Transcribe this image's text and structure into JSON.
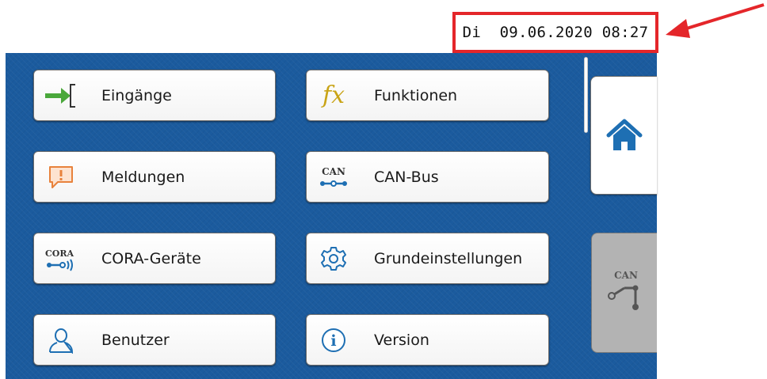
{
  "header": {
    "datetime": "Di  09.06.2020 08:27"
  },
  "menu": {
    "items": [
      {
        "label": "Eingänge",
        "icon": "input-arrow-icon"
      },
      {
        "label": "Funktionen",
        "icon": "function-fx-icon"
      },
      {
        "label": "Meldungen",
        "icon": "message-alert-icon"
      },
      {
        "label": "CAN-Bus",
        "icon": "can-bus-icon"
      },
      {
        "label": "CORA-Geräte",
        "icon": "cora-devices-icon"
      },
      {
        "label": "Grundeinstellungen",
        "icon": "gear-icon"
      },
      {
        "label": "Benutzer",
        "icon": "user-icon"
      },
      {
        "label": "Version",
        "icon": "info-icon"
      }
    ]
  },
  "icon_text": {
    "can": "CAN",
    "cora": "CORA",
    "fx": "fx",
    "info": "i"
  },
  "colors": {
    "panel": "#1b5b9e",
    "highlight": "#e4262a",
    "home": "#1e6fb3"
  }
}
